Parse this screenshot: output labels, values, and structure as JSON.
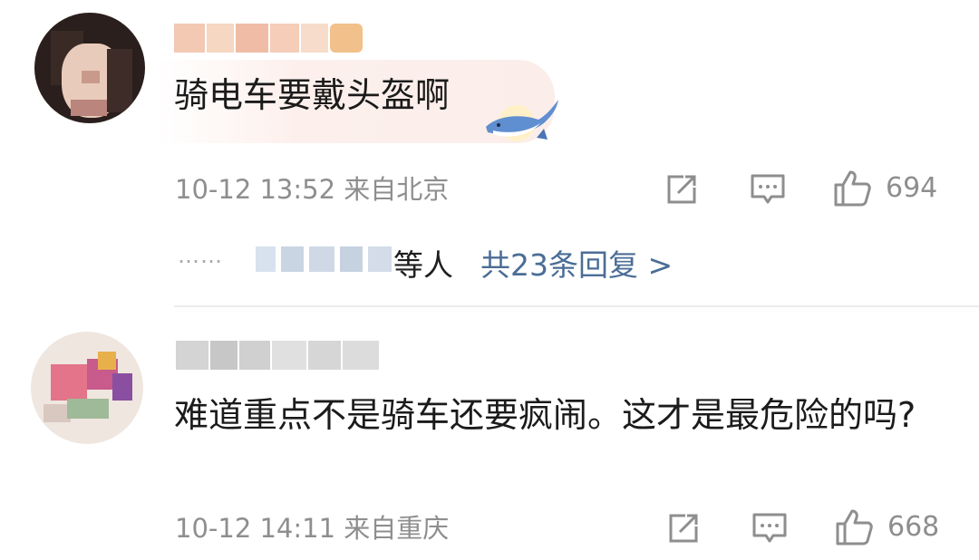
{
  "comments": [
    {
      "text": "骑电车要戴头盔啊",
      "time": "10-12 13:52",
      "location": "来自北京",
      "likes": "694",
      "icons": {
        "repost": "repost-icon",
        "comment": "comment-icon",
        "like": "thumbs-up-icon"
      },
      "replies": {
        "ellipsis": "……",
        "suffix": "等人",
        "link": "共23条回复 >"
      }
    },
    {
      "text": "难道重点不是骑车还要疯闹。这才是最危险的吗?",
      "time": "10-12 14:11",
      "location": "来自重庆",
      "likes": "668",
      "icons": {
        "repost": "repost-icon",
        "comment": "comment-icon",
        "like": "thumbs-up-icon"
      }
    }
  ],
  "colors": {
    "text": "#1b1b1b",
    "meta": "#8e8e8e",
    "link": "#4b6d96",
    "divider": "#ececec"
  }
}
